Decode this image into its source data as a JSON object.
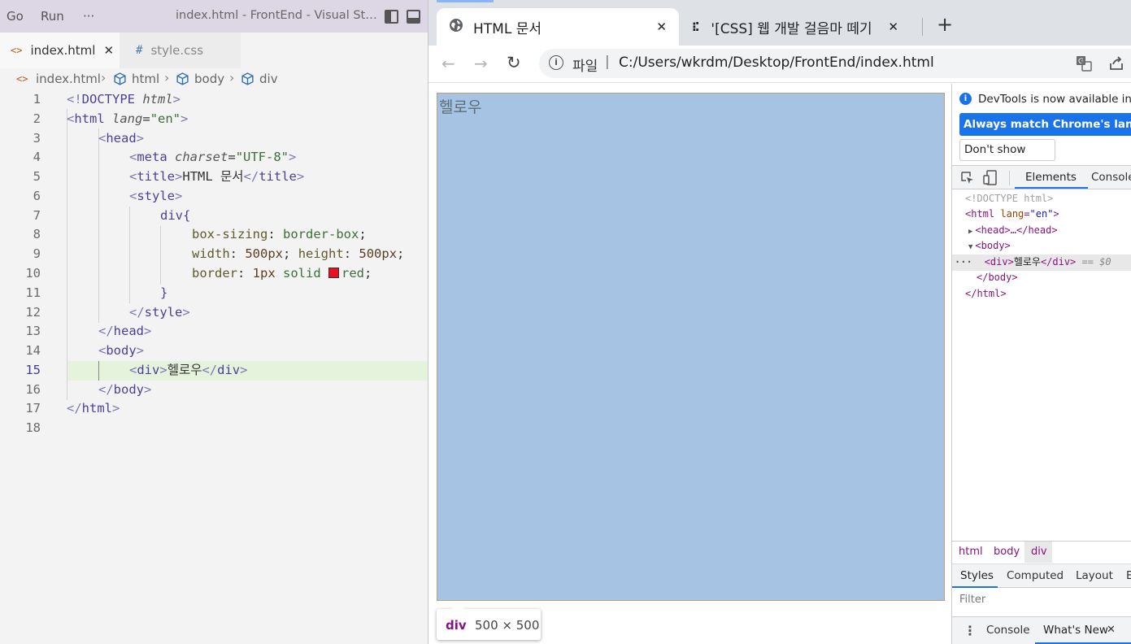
{
  "vscode": {
    "menu": [
      "Go",
      "Run",
      "···"
    ],
    "window_title": "index.html - FrontEnd - Visual Studi...",
    "tabs": [
      {
        "icon": "<>",
        "label": "index.html",
        "close": "✕"
      },
      {
        "icon": "#",
        "label": "style.css"
      }
    ],
    "breadcrumb": [
      "index.html",
      "html",
      "body",
      "div"
    ],
    "line_numbers": [
      "1",
      "2",
      "3",
      "4",
      "5",
      "6",
      "7",
      "8",
      "9",
      "10",
      "11",
      "12",
      "13",
      "14",
      "15",
      "16",
      "17",
      "18"
    ],
    "current_line": "15",
    "code": {
      "l1": {
        "lt": "<!",
        "tag": "DOCTYPE",
        "attr": "html",
        "gt": ">"
      },
      "l2": {
        "lt": "<",
        "tag": "html",
        "attr": "lang",
        "eq": "=",
        "val": "\"en\"",
        "gt": ">"
      },
      "l3": {
        "lt": "<",
        "tag": "head",
        "gt": ">"
      },
      "l4": {
        "lt": "<",
        "tag": "meta",
        "attr": "charset",
        "eq": "=",
        "val": "\"UTF-8\"",
        "gt": ">"
      },
      "l5": {
        "lt": "<",
        "tag": "title",
        "gt": ">",
        "text": "HTML 문서",
        "clt": "</",
        "ctag": "title",
        "cgt": ">"
      },
      "l6": {
        "lt": "<",
        "tag": "style",
        "gt": ">"
      },
      "l7": {
        "sel": "div",
        "brace": "{"
      },
      "l8": {
        "prop": "box-sizing",
        "colon": ": ",
        "val": "border-box",
        "semi": ";"
      },
      "l9": {
        "prop1": "width",
        "colon1": ": ",
        "num1": "500",
        "unit1": "px",
        "semi1": "; ",
        "prop2": "height",
        "colon2": ": ",
        "num2": "500",
        "unit2": "px",
        "semi2": ";"
      },
      "l10": {
        "prop": "border",
        "colon": ": ",
        "num": "1",
        "unit": "px",
        "kw": " solid ",
        "color": "red",
        "semi": ";"
      },
      "l11": {
        "brace": "}"
      },
      "l12": {
        "lt": "</",
        "tag": "style",
        "gt": ">"
      },
      "l13": {
        "lt": "</",
        "tag": "head",
        "gt": ">"
      },
      "l14": {
        "lt": "<",
        "tag": "body",
        "gt": ">"
      },
      "l15": {
        "lt": "<",
        "tag": "div",
        "gt": ">",
        "text": "헬로우",
        "clt": "</",
        "ctag": "div",
        "cgt": ">"
      },
      "l16": {
        "lt": "</",
        "tag": "body",
        "gt": ">"
      },
      "l17": {
        "lt": "</",
        "tag": "html",
        "gt": ">"
      }
    }
  },
  "chrome": {
    "tabs": [
      {
        "title": "HTML 문서",
        "close": "✕",
        "icon": "globe-icon"
      },
      {
        "title": "'[CSS] 웹 개발 걸음마 떼기",
        "close": "✕",
        "icon": "dots-icon"
      }
    ],
    "new_tab": "+",
    "address": {
      "scheme_label": "파일",
      "separator": "|",
      "url": "C:/Users/wkrdm/Desktop/FrontEnd/index.html"
    },
    "page": {
      "div_text": "헬로우"
    },
    "tooltip": {
      "tag": "div",
      "size": "500 × 500"
    }
  },
  "devtools": {
    "info_message": "DevTools is now available in Kor",
    "language_button": "Always match Chrome's language",
    "dont_show_button": "Don't show again",
    "tabs": [
      "Elements",
      "Console"
    ],
    "tree": {
      "doctype": "<!DOCTYPE html>",
      "html_open": {
        "lt": "<",
        "tag": "html",
        "attr": "lang",
        "eq": "=",
        "val": "\"en\"",
        "gt": ">"
      },
      "head": {
        "arrow": "▶",
        "text": "<head>…</head>"
      },
      "body_open": {
        "arrow": "▼",
        "text": "<body>"
      },
      "div": {
        "dots": "···",
        "open": "<div>",
        "text": "헬로우",
        "close": "</div>",
        "eq": " == $0"
      },
      "body_close": "</body>",
      "html_close": "</html>"
    },
    "crumbs": [
      "html",
      "body",
      "div"
    ],
    "subtabs": [
      "Styles",
      "Computed",
      "Layout",
      "E"
    ],
    "filter_placeholder": "Filter",
    "drawer": {
      "menu": "⋮",
      "tabs": [
        "Console",
        "What's New"
      ],
      "close": "✕"
    }
  }
}
